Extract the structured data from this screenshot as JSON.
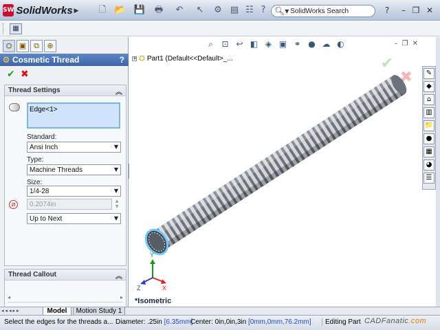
{
  "app": {
    "name": "SolidWorks",
    "logo_text": "SW"
  },
  "search": {
    "label": "SolidWorks Search"
  },
  "colors": {
    "accent": "#3e64a6",
    "ok": "#1ca31c",
    "cancel": "#dd1111",
    "thread_edge": "#6ec7ff"
  },
  "property_manager": {
    "title": "Cosmetic Thread",
    "help": "?",
    "groups": {
      "thread_settings": {
        "title": "Thread Settings",
        "edge_selection": "Edge<1>",
        "standard_label": "Standard:",
        "standard_value": "Ansi Inch",
        "type_label": "Type:",
        "type_value": "Machine Threads",
        "size_label": "Size:",
        "size_value": "1/4-28",
        "diameter_value": "0.2074in",
        "end_condition_value": "Up to Next"
      },
      "thread_callout": {
        "title": "Thread Callout"
      }
    }
  },
  "graphics": {
    "tree_item": "Part1  (Default<<Default>_...",
    "view_label": "*Isometric",
    "triad": {
      "x": "X",
      "y": "Y",
      "z": "Z"
    }
  },
  "tabs": [
    {
      "label": "Model"
    },
    {
      "label": "Motion Study 1"
    }
  ],
  "status": {
    "message": "Select the edges for the threads a...",
    "diameter_label": "Diameter: .25in ",
    "diameter_metric": "[6.35mm]",
    "center_label": "Center: 0in,0in,3in ",
    "center_metric": "[0mm,0mm,76.2mm]",
    "mode": "Editing Part",
    "brand_a": "CADFanatic",
    "brand_b": ".com"
  }
}
